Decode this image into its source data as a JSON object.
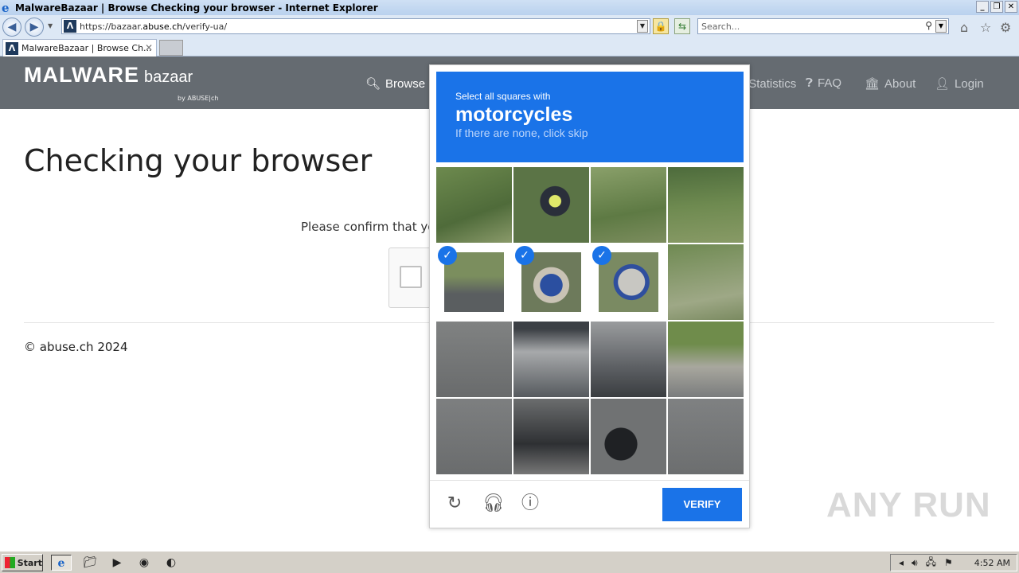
{
  "window": {
    "title": "MalwareBazaar | Browse Checking your browser - Internet Explorer",
    "controls": [
      "_",
      "❐",
      "✕"
    ]
  },
  "addressbar": {
    "url_prefix": "https://bazaar.",
    "url_domain": "abuse.ch",
    "url_path": "/verify-ua/",
    "search_placeholder": "Search..."
  },
  "tab": {
    "label": "MalwareBazaar | Browse Ch...",
    "close": "✕"
  },
  "site": {
    "logo_main": "MALWARE",
    "logo_sub": "bazaar",
    "logo_by": "by ABUSE|ch",
    "nav": [
      {
        "label": "Browse",
        "icon": "search-icon"
      },
      {
        "label": "Statistics",
        "icon": "chart-icon"
      },
      {
        "label": "FAQ",
        "icon": "question-icon"
      },
      {
        "label": "About",
        "icon": "bank-icon"
      },
      {
        "label": "Login",
        "icon": "user-icon"
      }
    ]
  },
  "page": {
    "heading": "Checking your browser",
    "confirm_text": "Please confirm that you",
    "copyright": "© abuse.ch 2024"
  },
  "captcha": {
    "instruction": "Select all squares with",
    "target": "motorcycles",
    "hint": "If there are none, click skip",
    "verify_label": "VERIFY",
    "selected_tiles": [
      4,
      5,
      6
    ]
  },
  "taskbar": {
    "start_label": "Start",
    "clock": "4:52 AM"
  },
  "watermark": "ANY RUN"
}
